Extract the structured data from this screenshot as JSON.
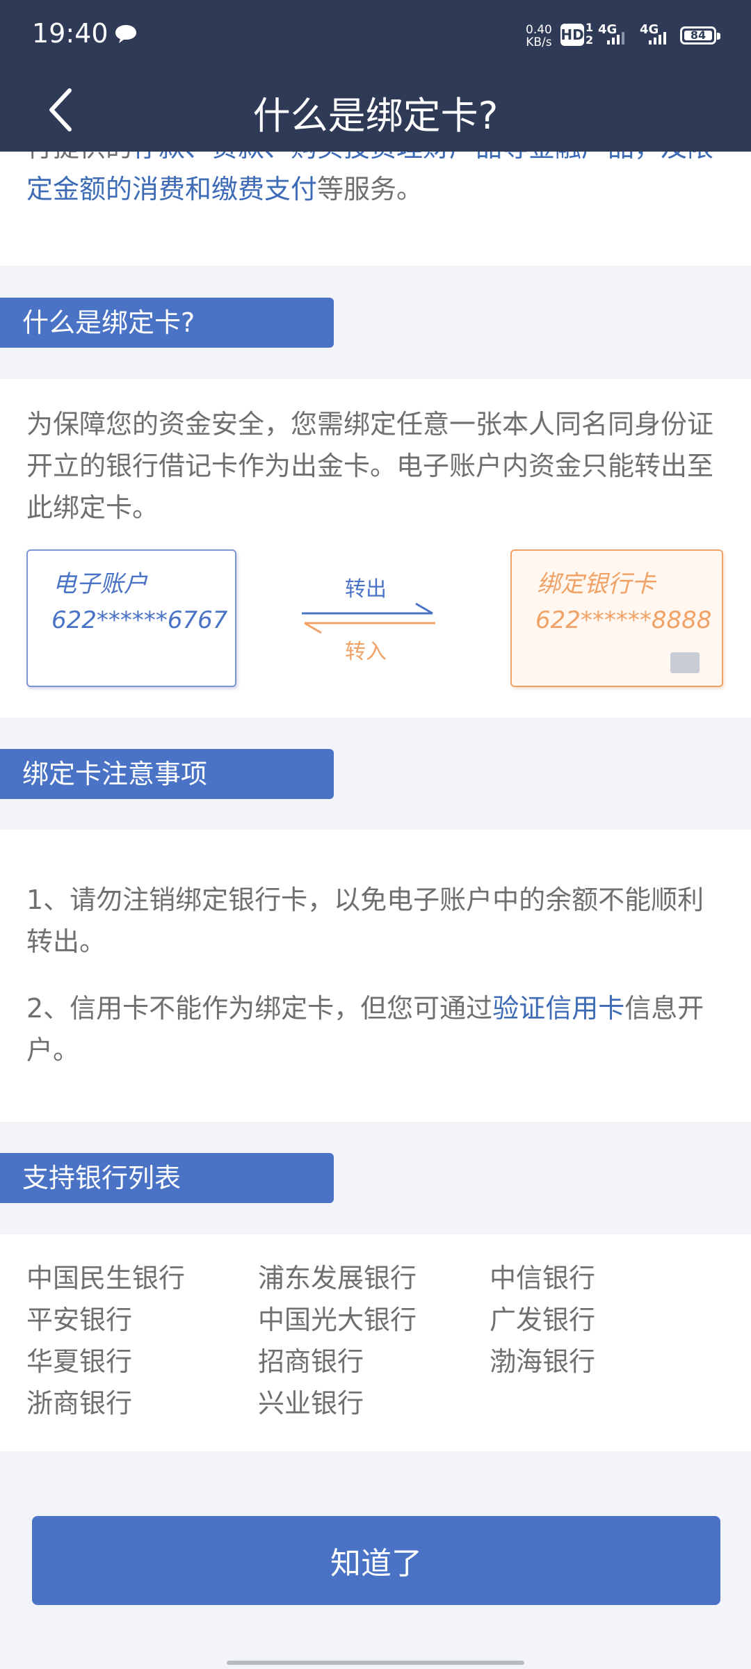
{
  "status_bar": {
    "time": "19:40",
    "net_speed_value": "0.40",
    "net_speed_unit": "KB/s",
    "hd_label": "HD",
    "sim1_label": "1",
    "sim2_label": "2",
    "signal1_label": "4G",
    "signal2_label": "4G",
    "battery": "84"
  },
  "nav": {
    "title": "什么是绑定卡?"
  },
  "intro": {
    "part1": "行提供的",
    "link1": "存款、贷款、购买投资理财产品等金融产品，及限定金额的消费和缴费支付",
    "part2": "等服务。"
  },
  "section_what": {
    "heading": "什么是绑定卡?",
    "text": "为保障您的资金安全，您需绑定任意一张本人同名同身份证开立的银行借记卡作为出金卡。电子账户内资金只能转出至此绑定卡。",
    "e_account_card": {
      "title": "电子账户",
      "number": "622******6767"
    },
    "bank_card": {
      "title": "绑定银行卡",
      "number": "622******8888"
    },
    "transfer_out": "转出",
    "transfer_in": "转入"
  },
  "section_notes": {
    "heading": "绑定卡注意事项",
    "note1": "1、请勿注销绑定银行卡，以免电子账户中的余额不能顺利转出。",
    "note2_part1": "2、信用卡不能作为绑定卡，但您可通过",
    "note2_link": "验证信用卡",
    "note2_part2": "信息开户。"
  },
  "section_banks": {
    "heading": "支持银行列表",
    "banks": [
      "中国民生银行",
      "浦东发展银行",
      "中信银行",
      "平安银行",
      "中国光大银行",
      "广发银行",
      "华夏银行",
      "招商银行",
      "渤海银行",
      "浙商银行",
      "兴业银行"
    ]
  },
  "footer": {
    "ok_label": "知道了"
  },
  "colors": {
    "header_bg": "#2f3a57",
    "accent": "#4a73c6",
    "link": "#3e6bb6",
    "orange": "#f0a266"
  }
}
